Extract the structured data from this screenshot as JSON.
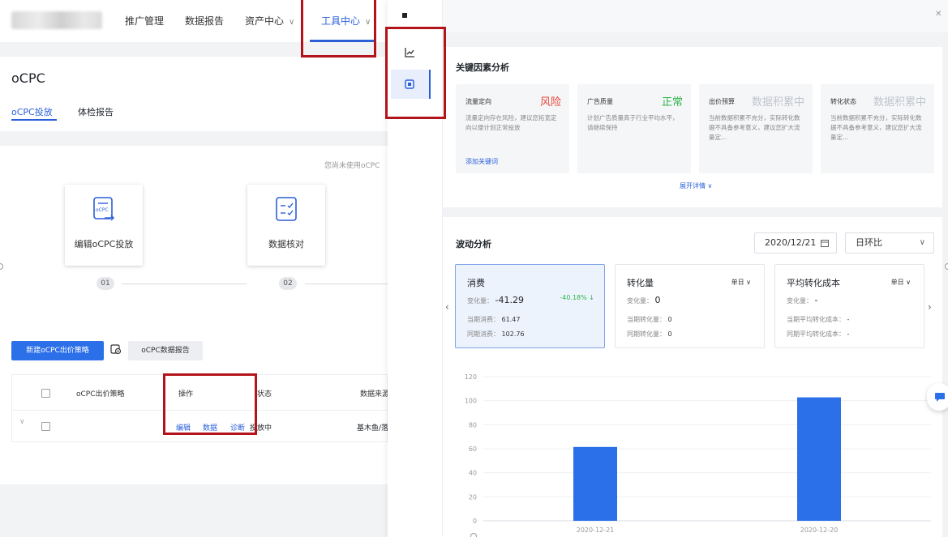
{
  "nav": {
    "items": [
      "推广管理",
      "数据报告",
      "资产中心",
      "工具中心"
    ],
    "active_index": 3
  },
  "page": {
    "title": "oCPC",
    "tabs": [
      "oCPC投放",
      "体检报告"
    ],
    "hint": "您尚未使用oCPC",
    "steps": [
      {
        "label": "编辑oCPC投放",
        "num": "01"
      },
      {
        "label": "数据核对",
        "num": "02"
      }
    ],
    "buttons": {
      "new_strategy": "新建oCPC出价策略",
      "report": "oCPC数据报告"
    },
    "table": {
      "headers": [
        "oCPC出价策略",
        "操作",
        "状态",
        "数据来源"
      ],
      "row": {
        "actions": [
          "编辑",
          "数据",
          "诊断"
        ],
        "status": "投放中",
        "source": "基木鱼/落"
      }
    }
  },
  "drawer": {
    "key_factors": {
      "title": "关键因素分析",
      "cards": [
        {
          "name": "流量定向",
          "status": "风险",
          "status_color": "#e5483b",
          "desc": "流量定向存在风险，建议您拓宽定向以便计划正常投放",
          "link": "添加关键词"
        },
        {
          "name": "广告质量",
          "status": "正常",
          "status_color": "#2db34b",
          "desc": "计划广告质量高于行业平均水平，请继续保持",
          "link": ""
        },
        {
          "name": "出价预算",
          "status": "数据积累中",
          "status_color": "#c0c4cc",
          "desc": "当前数据积累不充分，实际转化数据不具备参考意义，建议您扩大流量定...",
          "link": ""
        },
        {
          "name": "转化状态",
          "status": "数据积累中",
          "status_color": "#c0c4cc",
          "desc": "当前数据积累不充分，实际转化数据不具备参考意义，建议您扩大流量定...",
          "link": ""
        }
      ],
      "expand": "展开详情"
    },
    "fluctuation": {
      "title": "波动分析",
      "date": "2020/12/21",
      "compare": "日环比",
      "metrics": [
        {
          "title": "消费",
          "change_label": "变化量：",
          "change": "-41.29",
          "pct": "-40.18%",
          "prev_label": "当期消费：",
          "prev": "61.47",
          "same_label": "同期消费：",
          "same": "102.76",
          "unit": ""
        },
        {
          "title": "转化量",
          "change_label": "变化量：",
          "change": "0",
          "pct": "",
          "prev_label": "当期转化量：",
          "prev": "0",
          "same_label": "同期转化量：",
          "same": "0",
          "unit": "单日"
        },
        {
          "title": "平均转化成本",
          "change_label": "变化量：",
          "change": "-",
          "pct": "",
          "prev_label": "当期平均转化成本：",
          "prev": "-",
          "same_label": "同期平均转化成本：",
          "same": "-",
          "unit": "单日"
        }
      ]
    }
  },
  "chart_data": {
    "type": "bar",
    "categories": [
      "2020-12-21",
      "2020-12-20"
    ],
    "values": [
      61.47,
      102.76
    ],
    "ylim": [
      0,
      120
    ],
    "yticks": [
      0,
      20,
      40,
      60,
      80,
      100,
      120
    ],
    "grid": true,
    "color": "#2b6fe9"
  }
}
